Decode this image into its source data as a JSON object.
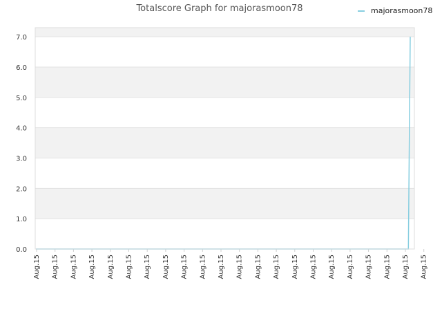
{
  "chart_data": {
    "type": "line",
    "title": "Totalscore Graph for majorasmoon78",
    "xlabel": "",
    "ylabel": "",
    "ylim": [
      0,
      7.3
    ],
    "y_ticks": [
      "0.0",
      "1.0",
      "2.0",
      "3.0",
      "4.0",
      "5.0",
      "6.0",
      "7.0"
    ],
    "y_tick_values": [
      0,
      1,
      2,
      3,
      4,
      5,
      6,
      7
    ],
    "x": [
      "Aug.15",
      "Aug.15",
      "Aug.15",
      "Aug.15",
      "Aug.15",
      "Aug.15",
      "Aug.15",
      "Aug.15",
      "Aug.15",
      "Aug.15",
      "Aug.15",
      "Aug.15",
      "Aug.15",
      "Aug.15",
      "Aug.15",
      "Aug.15",
      "Aug.15",
      "Aug.15",
      "Aug.15",
      "Aug.15",
      "Aug.15",
      "Aug.15"
    ],
    "series": [
      {
        "name": "majorasmoon78",
        "color": "#87cee0",
        "values": [
          0,
          0,
          0,
          0,
          0,
          0,
          0,
          0,
          0,
          0,
          0,
          0,
          0,
          0,
          0,
          0,
          0,
          0,
          0,
          0,
          0,
          0,
          0,
          0,
          0,
          0,
          0,
          0,
          0,
          0,
          0,
          0,
          0,
          0,
          0,
          0,
          0,
          0,
          0,
          0,
          0,
          0,
          0,
          0,
          0,
          0,
          0,
          0,
          0,
          0,
          0,
          0,
          0,
          0,
          0,
          0,
          0,
          0,
          0,
          0,
          0,
          0,
          0,
          0,
          0,
          0,
          0,
          0,
          0,
          0,
          0,
          0,
          0,
          0,
          0,
          0,
          0,
          0,
          0,
          0,
          0,
          0,
          0,
          0,
          0,
          0,
          0,
          0,
          0,
          0,
          0,
          0,
          0,
          0,
          0,
          0,
          0,
          0,
          0,
          0,
          0,
          0,
          0,
          0,
          0,
          0,
          0,
          0,
          0,
          0,
          0,
          0,
          0,
          0,
          0,
          0,
          0,
          0,
          0,
          0,
          0,
          0,
          0,
          0,
          0,
          0,
          0,
          0,
          0,
          0,
          0,
          0,
          0,
          0,
          0,
          0,
          0,
          0,
          0,
          0,
          0,
          0,
          0,
          0,
          0,
          0,
          0,
          0,
          0,
          0,
          0,
          0,
          0,
          0,
          0,
          0,
          0,
          0,
          0,
          0,
          0,
          0,
          0,
          0,
          0,
          0,
          0,
          0,
          0,
          0,
          0,
          0,
          0,
          0,
          0,
          0,
          0,
          0,
          0,
          0,
          0,
          0,
          0,
          0,
          0,
          0,
          0,
          0,
          0,
          0,
          0,
          0,
          0,
          0,
          0,
          0,
          0,
          0,
          0,
          0,
          0,
          0,
          7
        ]
      }
    ],
    "legend_position": "top-right",
    "grid": true,
    "band_colors": [
      "#ffffff",
      "#f2f2f2"
    ]
  }
}
